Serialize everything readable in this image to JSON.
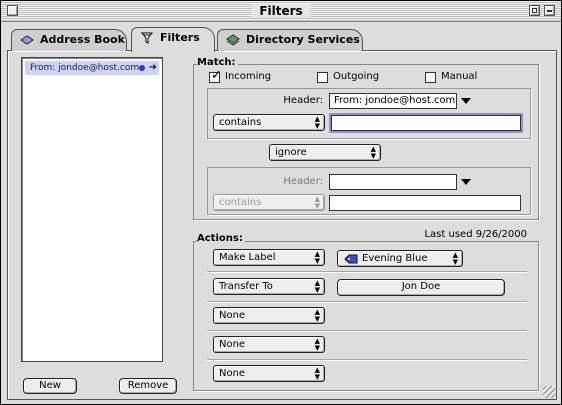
{
  "window": {
    "title": "Filters"
  },
  "tabs": [
    {
      "label": "Address Book",
      "icon": "address-book-icon"
    },
    {
      "label": "Filters",
      "icon": "filter-funnel-icon"
    },
    {
      "label": "Directory Services",
      "icon": "directory-services-icon"
    }
  ],
  "filters": {
    "items": [
      {
        "label": "From: jondoe@host.com"
      }
    ],
    "new_label": "New",
    "remove_label": "Remove"
  },
  "match": {
    "heading": "Match:",
    "incoming": {
      "label": "Incoming",
      "checked": true
    },
    "outgoing": {
      "label": "Outgoing",
      "checked": false
    },
    "manual": {
      "label": "Manual",
      "checked": false
    },
    "criteria1": {
      "header_label": "Header:",
      "header_value": "From: jondoe@host.com",
      "operator": "contains",
      "value": ""
    },
    "conjunction": "ignore",
    "criteria2": {
      "header_label": "Header:",
      "header_value": "",
      "operator": "contains",
      "value": ""
    }
  },
  "actions": {
    "heading": "Actions:",
    "last_used": "Last used 9/26/2000",
    "rows": [
      {
        "action": "Make Label",
        "param": "Evening Blue",
        "param_color": "#3a4fd8"
      },
      {
        "action": "Transfer To",
        "param": "Jon Doe"
      },
      {
        "action": "None"
      },
      {
        "action": "None"
      },
      {
        "action": "None"
      }
    ]
  }
}
